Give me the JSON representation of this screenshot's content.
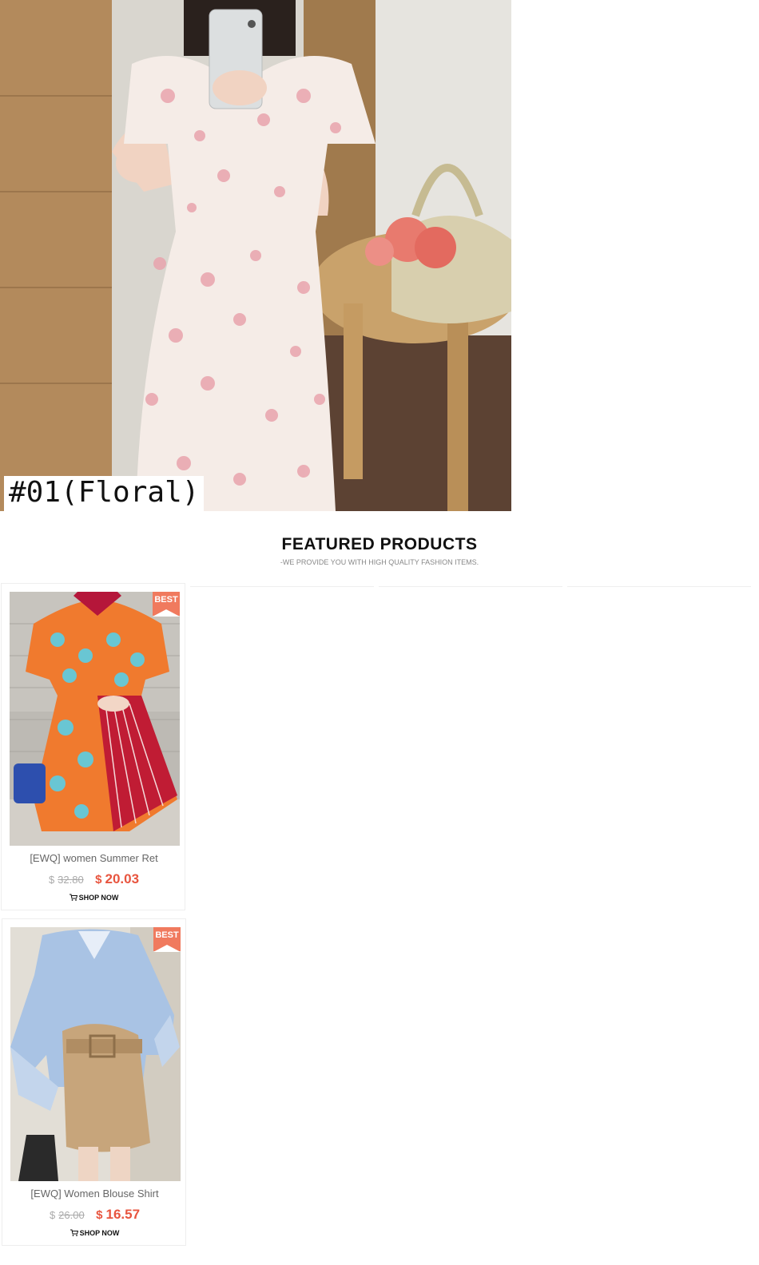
{
  "hero": {
    "label": "#01(Floral)"
  },
  "featured": {
    "title": "FEATURED PRODUCTS",
    "subtitle": "-WE PROVIDE YOU WITH HIGH QUALITY FASHION ITEMS."
  },
  "products": [
    {
      "badge": "BEST",
      "name": "[EWQ] women Summer Ret",
      "currency": "$",
      "old_price": "32.80",
      "new_price": "20.03",
      "cta": "SHOP NOW"
    },
    {
      "badge": "BEST",
      "name": "[EWQ] Women Blouse Shirt",
      "currency": "$",
      "old_price": "26.00",
      "new_price": "16.57",
      "cta": "SHOP NOW"
    }
  ],
  "colors": {
    "badge": "#f07a5e",
    "sale_price": "#e8553f",
    "old_price": "#aaaaaa"
  },
  "icons": {
    "cart": "shopping-cart-icon"
  }
}
